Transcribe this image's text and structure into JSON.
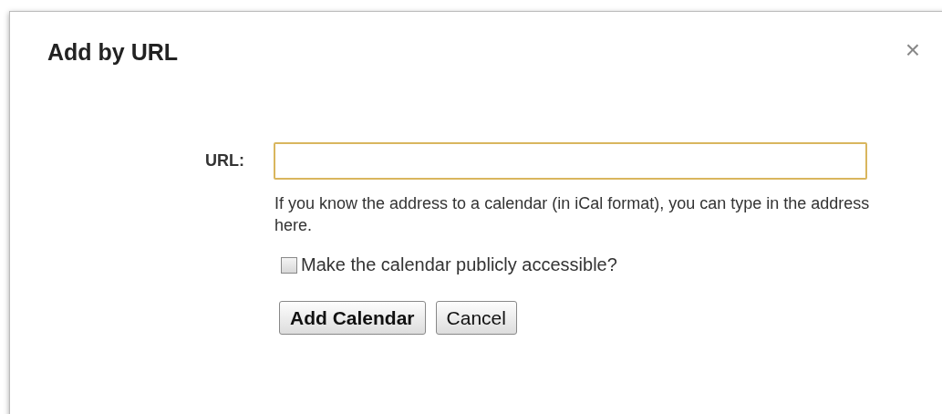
{
  "dialog": {
    "title": "Add by URL",
    "close": "×"
  },
  "url_field": {
    "label": "URL:",
    "focused": true
  },
  "help": "If you know the address to a calendar (in iCal format), you can type in the address here.",
  "public_option": {
    "label": "Make the calendar publicly accessible?",
    "checked": false
  },
  "buttons": [
    {
      "label": "Add Calendar",
      "kind": "primary"
    },
    {
      "label": "Cancel",
      "kind": "secondary"
    }
  ]
}
